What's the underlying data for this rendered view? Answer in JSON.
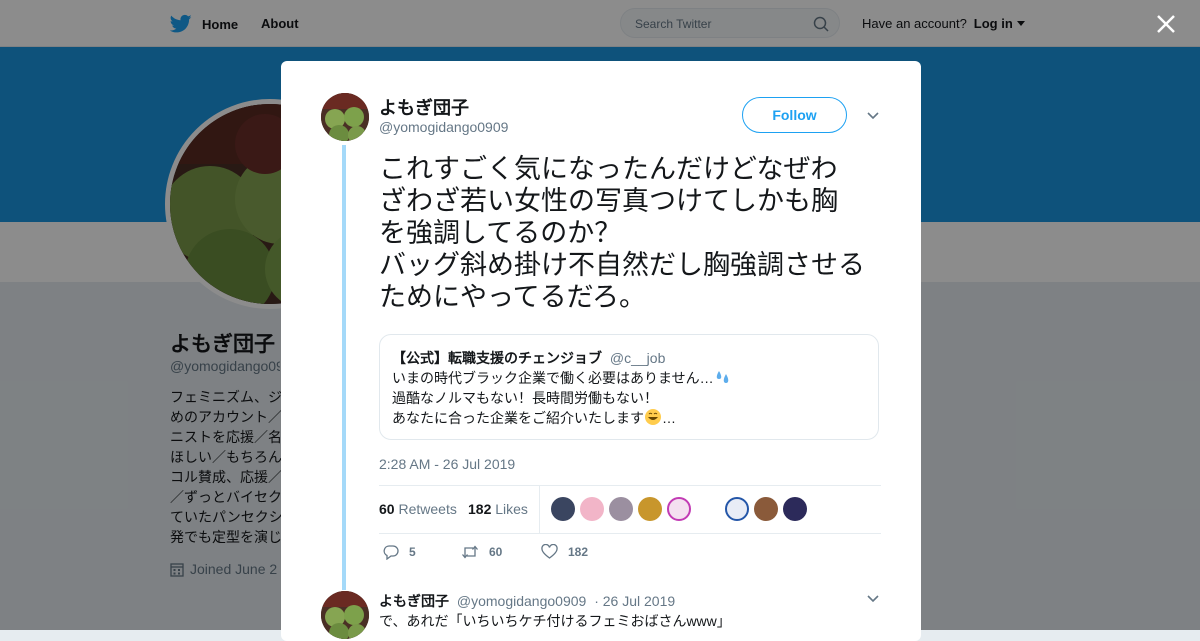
{
  "nav": {
    "home_label": "Home",
    "about_label": "About",
    "search_placeholder": "Search Twitter",
    "account_prompt": "Have an account?",
    "login_label": "Log in",
    "brand_color": "#1da1f2"
  },
  "profile": {
    "name": "よもぎ団子",
    "handle": "@yomogidango0909",
    "bio_lines": [
      "フェミニズム、ジ",
      "めのアカウント／",
      "ニストを応援／名",
      "ほしい／もちろん",
      "コル賛成、応援／",
      "／ずっとバイセク",
      "ていたパンセクシ",
      "発でも定型を演じ"
    ],
    "joined": "Joined June 2",
    "banner_color": "#1b95e0"
  },
  "tweet": {
    "author_name": "よもぎ団子",
    "author_handle": "@yomogidango0909",
    "follow_label": "Follow",
    "text_lines": [
      "これすごく気になったんだけどなぜわ",
      "ざわざ若い女性の写真つけてしかも胸",
      "を強調してるのか？",
      "バッグ斜め掛け不自然だし胸強調させる",
      "ためにやってるだろ。"
    ],
    "quote": {
      "name": "【公式】転職支援のチェンジョブ",
      "handle": "@c__job",
      "line1": "いまの時代ブラック企業で働く必要はありません…",
      "line2": "過酷なノルマもない！長時間労働もない！",
      "line3_pre": "あなたに合った企業をご紹介いたします",
      "line3_post": "…",
      "emoji1": "sweat-droplets-emoji",
      "emoji2": "grinning-face-emoji"
    },
    "timestamp": "2:28 AM - 26 Jul 2019",
    "retweets_count": "60",
    "retweets_label": "Retweets",
    "likes_count": "182",
    "likes_label": "Likes",
    "actions": {
      "replies": "5",
      "retweets": "60",
      "likes": "182"
    }
  },
  "reply": {
    "author_name": "よもぎ団子",
    "author_handle": "@yomogidango0909",
    "date": "· 26 Jul 2019",
    "text": "で、あれだ「いちいちケチ付けるフェミおばさんwww」"
  }
}
